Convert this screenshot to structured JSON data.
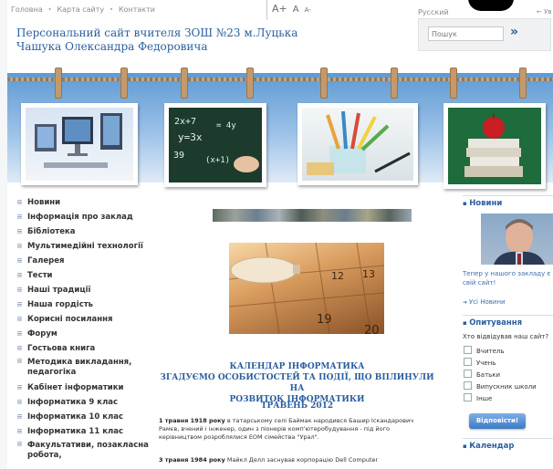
{
  "topnav": {
    "home": "Головна",
    "sitemap": "Карта сайту",
    "contacts": "Контакти",
    "separator": "•"
  },
  "fontsize": {
    "large": "A+",
    "normal": "A",
    "small": "A-"
  },
  "lang": "Русский",
  "login": "← Ув",
  "search": {
    "placeholder": "Пошук",
    "button": "»"
  },
  "site": {
    "title_line1": "Персональний сайт вчителя ЗОШ №23 м.Луцька",
    "title_line2": "Чашука Олександра Федоровича"
  },
  "menu": [
    "Новини",
    "Інформація про заклад",
    "Бібліотека",
    "Мультимедійні технології",
    "Галерея",
    "Тести",
    "Наші традиції",
    "Наша гордість",
    "Корисні посилання",
    "Форум",
    "Гостьова книга",
    "Методика викладання, педагогіка",
    "Кабінет інформатики",
    "Інформатика 9 клас",
    "Інформатика 10 клас",
    "Інформатика 11 клас",
    "Факультативи, позакласна робота,"
  ],
  "article": {
    "title_l1": "КАЛЕНДАР ІНФОРМАТИКА",
    "title_l2": "ЗГАДУЄМО ОСОБИСТОСТЕЙ ТА ПОДІЇ, ЩО ВПЛИНУЛИ НА",
    "title_l3": "РОЗВИТОК ІНФОРМАТИКИ",
    "date": "ТРАВЕНЬ 2012",
    "p1_bold": "1 травня 1918 року",
    "p1_text": " в татарському селі Баймак народився Башир Іскандарович Рамєв, вчений і інженер, один з піонерів комп'ютеробудування - під його керівництвом розроблялися ЕОМ сімейства \"Урал\".",
    "p2_bold": "3 травня 1984 року",
    "p2_text": " Майкл Делл заснував корпорацію Dell Computer"
  },
  "right": {
    "news_head": "Новини",
    "news_text": "Тепер у нашого закладу є свій сайт!",
    "all_news": "Усі Новини",
    "poll_head": "Опитування",
    "poll_q": "Хто відвідував наш сайт?",
    "options": [
      "Вчитель",
      "Учень",
      "Батьки",
      "Випускник школи",
      "Інше"
    ],
    "vote": "Відповісти!",
    "cal_head": "Календар"
  },
  "colors": {
    "link": "#2b5fa0",
    "banner": "#6ea3d8"
  }
}
